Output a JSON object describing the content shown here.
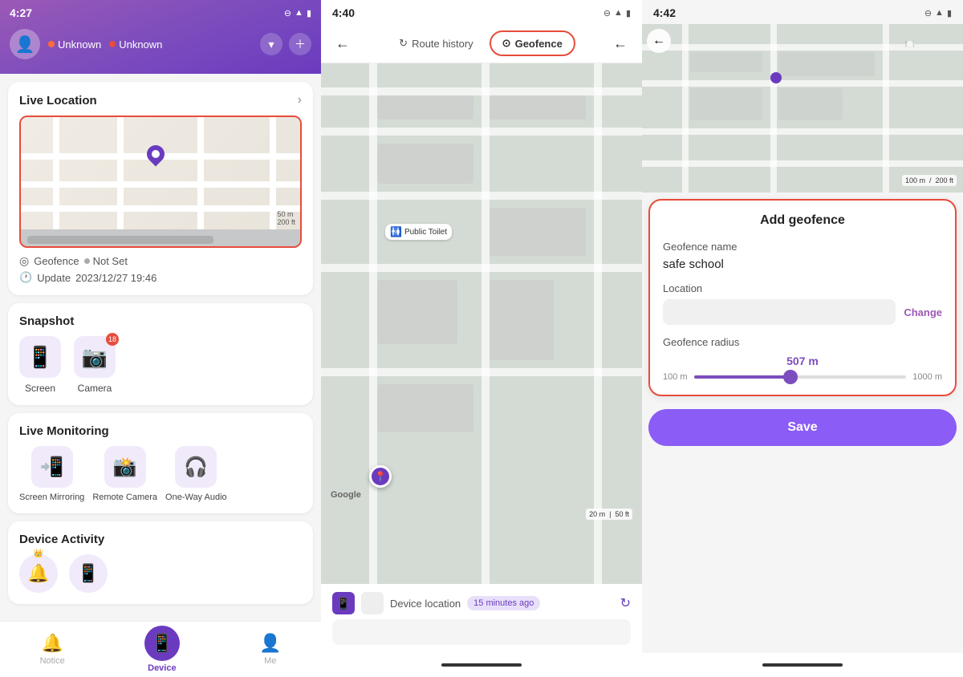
{
  "panel1": {
    "time": "4:27",
    "user1": "Unknown",
    "user2": "Unknown",
    "live_location_title": "Live Location",
    "geofence_label": "Geofence",
    "geofence_status": "Not Set",
    "update_label": "Update",
    "update_time": "2023/12/27 19:46",
    "map_scale1": "50 m",
    "map_scale2": "200 ft",
    "snapshot_title": "Snapshot",
    "snapshot_screen": "Screen",
    "snapshot_camera": "Camera",
    "snapshot_camera_badge": "18",
    "live_monitoring_title": "Live Monitoring",
    "screen_mirroring": "Screen Mirroring",
    "remote_camera": "Remote Camera",
    "one_way_audio": "One-Way Audio",
    "device_activity_title": "Device Activity",
    "nav_notice": "Notice",
    "nav_device": "Device",
    "nav_me": "Me"
  },
  "panel2": {
    "time": "4:40",
    "route_history": "Route history",
    "geofence": "Geofence",
    "device_location": "Device location",
    "time_ago": "15 minutes ago",
    "map_scale1": "20 m",
    "map_scale2": "50 ft",
    "toilet_label": "Public Toilet",
    "google_label": "Google"
  },
  "panel3": {
    "time": "4:42",
    "add_geofence_title": "Add geofence",
    "geofence_name_label": "Geofence name",
    "geofence_name_value": "safe school",
    "location_label": "Location",
    "change_label": "Change",
    "geofence_radius_label": "Geofence radius",
    "radius_value": "507 m",
    "radius_min": "100 m",
    "radius_max": "1000 m",
    "save_label": "Save",
    "map_scale1": "100 m",
    "map_scale2": "200 ft"
  }
}
